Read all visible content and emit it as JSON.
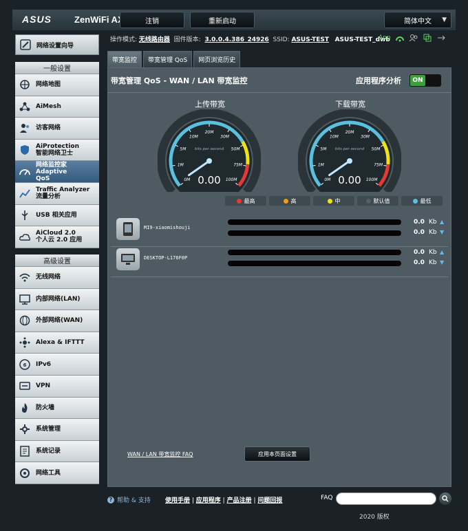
{
  "header": {
    "logo": "ASUS",
    "product": "ZenWiFi AX",
    "logout": "注销",
    "reboot": "重新启动",
    "language": "简体中文"
  },
  "status": {
    "mode_label": "操作模式:",
    "mode_value": "无线路由器",
    "firmware_label": "固件版本:",
    "firmware_value": "3.0.0.4.386_24926",
    "ssid_label": "SSID:",
    "ssid_1": "ASUS-TEST",
    "ssid_2": "ASUS-TEST_dwb",
    "app": "App"
  },
  "sidebar": {
    "setup": "网络设置向导",
    "general_title": "一般设置",
    "general": [
      {
        "label": "网络地图",
        "icon": "network-map-icon"
      },
      {
        "label": "AiMesh",
        "icon": "aimesh-icon"
      },
      {
        "label": "访客网络",
        "icon": "guest-network-icon"
      },
      {
        "label": "AiProtection",
        "label2": "智能网络卫士",
        "icon": "shield-icon"
      },
      {
        "label": "网络监控家 Adaptive",
        "label2": "QoS",
        "icon": "speedometer-icon",
        "active": true
      },
      {
        "label": "Traffic Analyzer",
        "label2": "流量分析",
        "icon": "chart-icon"
      },
      {
        "label": "USB 相关应用",
        "icon": "usb-icon"
      },
      {
        "label": "AiCloud 2.0",
        "label2": "个人云 2.0 应用",
        "icon": "cloud-icon"
      }
    ],
    "advanced_title": "高级设置",
    "advanced": [
      {
        "label": "无线网络",
        "icon": "wifi-icon"
      },
      {
        "label": "内部网络(LAN)",
        "icon": "lan-icon"
      },
      {
        "label": "外部网络(WAN)",
        "icon": "globe-icon"
      },
      {
        "label": "Alexa & IFTTT",
        "icon": "alexa-icon"
      },
      {
        "label": "IPv6",
        "icon": "ipv6-icon"
      },
      {
        "label": "VPN",
        "icon": "vpn-icon"
      },
      {
        "label": "防火墙",
        "icon": "firewall-icon"
      },
      {
        "label": "系统管理",
        "icon": "admin-icon"
      },
      {
        "label": "系统记录",
        "icon": "log-icon"
      },
      {
        "label": "网络工具",
        "icon": "tools-icon"
      }
    ]
  },
  "tabs": [
    "带宽监控",
    "带宽管理 QoS",
    "网页浏览历史"
  ],
  "main": {
    "title": "带宽管理 QoS - WAN / LAN 带宽监控",
    "analysis_label": "应用程序分析",
    "toggle": "ON",
    "upload_label": "上传带宽",
    "download_label": "下载带宽",
    "gauge_unit": "bits per second",
    "gauge_ticks": [
      "0M",
      "1M",
      "5M",
      "10M",
      "20M",
      "30M",
      "50M",
      "75M",
      "100M"
    ],
    "upload_value": "0.00",
    "download_value": "0.00",
    "legend": [
      {
        "label": "最高",
        "color": "#e53935"
      },
      {
        "label": "高",
        "color": "#f39c12"
      },
      {
        "label": "中",
        "color": "#f1e30f"
      },
      {
        "label": "默认值",
        "color": "#555f65"
      },
      {
        "label": "最低",
        "color": "#5bc0de"
      }
    ],
    "clients": [
      {
        "name": "MI9-xiaomishouji",
        "up": "0.0",
        "down": "0.0",
        "unit": "Kb",
        "icon": "phone-icon"
      },
      {
        "name": "DESKTOP-L176F0P",
        "up": "0.0",
        "down": "0.0",
        "unit": "Kb",
        "icon": "monitor-icon"
      }
    ],
    "faq_link": "WAN / LAN 带宽监控 FAQ",
    "apply_button": "应用本页面设置"
  },
  "footer": {
    "help": "帮助 & 支持",
    "links": [
      "使用手册",
      "应用程序",
      "产品注册",
      "问题回报"
    ],
    "faq": "FAQ",
    "copyright": "2020 版权"
  },
  "colors": {
    "accent": "#3ba13b",
    "active_nav": "#345a7e",
    "gauge_cyan": "#5bc0de"
  }
}
